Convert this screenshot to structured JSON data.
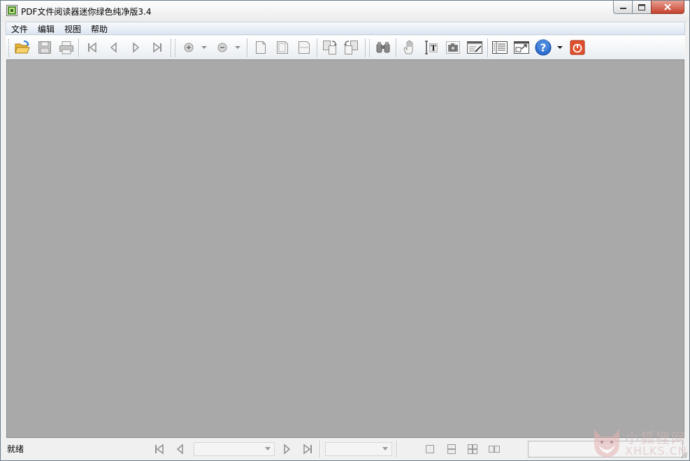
{
  "window": {
    "title": "PDF文件阅读器迷你绿色纯净版3.4",
    "controls": {
      "minimize": "minimize-icon",
      "maximize": "maximize-icon",
      "close": "close-icon"
    }
  },
  "menu": {
    "items": [
      {
        "label": "文件"
      },
      {
        "label": "编辑"
      },
      {
        "label": "视图"
      },
      {
        "label": "帮助"
      }
    ]
  },
  "toolbar": {
    "buttons": [
      {
        "id": "open",
        "icon": "open-folder-icon",
        "enabled": true
      },
      {
        "id": "save",
        "icon": "save-icon",
        "enabled": false
      },
      {
        "id": "print",
        "icon": "print-icon",
        "enabled": false
      },
      {
        "id": "first-page",
        "icon": "first-page-icon",
        "enabled": false
      },
      {
        "id": "prev-page",
        "icon": "prev-page-icon",
        "enabled": false
      },
      {
        "id": "next-page",
        "icon": "next-page-icon",
        "enabled": false
      },
      {
        "id": "last-page",
        "icon": "last-page-icon",
        "enabled": false
      },
      {
        "id": "zoom-in",
        "icon": "zoom-in-icon",
        "enabled": false
      },
      {
        "id": "zoom-out",
        "icon": "zoom-out-icon",
        "enabled": false
      },
      {
        "id": "actual-size",
        "icon": "actual-size-icon",
        "enabled": false
      },
      {
        "id": "fit-page",
        "icon": "fit-page-icon",
        "enabled": false
      },
      {
        "id": "fit-width",
        "icon": "fit-width-icon",
        "enabled": false
      },
      {
        "id": "rotate-cw",
        "icon": "rotate-clockwise-icon",
        "enabled": false
      },
      {
        "id": "rotate-ccw",
        "icon": "rotate-counterclockwise-icon",
        "enabled": false
      },
      {
        "id": "find",
        "icon": "binoculars-icon",
        "enabled": false
      },
      {
        "id": "hand",
        "icon": "hand-tool-icon",
        "enabled": false
      },
      {
        "id": "text-select",
        "icon": "text-select-icon",
        "enabled": true
      },
      {
        "id": "snapshot",
        "icon": "snapshot-icon",
        "enabled": false
      },
      {
        "id": "annotate",
        "icon": "annotate-icon",
        "enabled": true
      },
      {
        "id": "bookmarks",
        "icon": "bookmarks-panel-icon",
        "enabled": true
      },
      {
        "id": "full-screen",
        "icon": "full-screen-icon",
        "enabled": true
      },
      {
        "id": "help",
        "icon": "help-icon",
        "enabled": true
      },
      {
        "id": "exit",
        "icon": "power-icon",
        "enabled": true
      }
    ]
  },
  "status": {
    "text": "就绪",
    "page_combo_value": "",
    "zoom_combo_value": ""
  },
  "watermark": {
    "line1": "小狐狸网",
    "line2": "XHLKS.CN"
  },
  "colors": {
    "viewport": "#a9a9a9",
    "menubar": "#dde5f1",
    "close_button": "#c5422d",
    "help_blue": "#2e6fcf",
    "exit_red": "#e0502e"
  }
}
